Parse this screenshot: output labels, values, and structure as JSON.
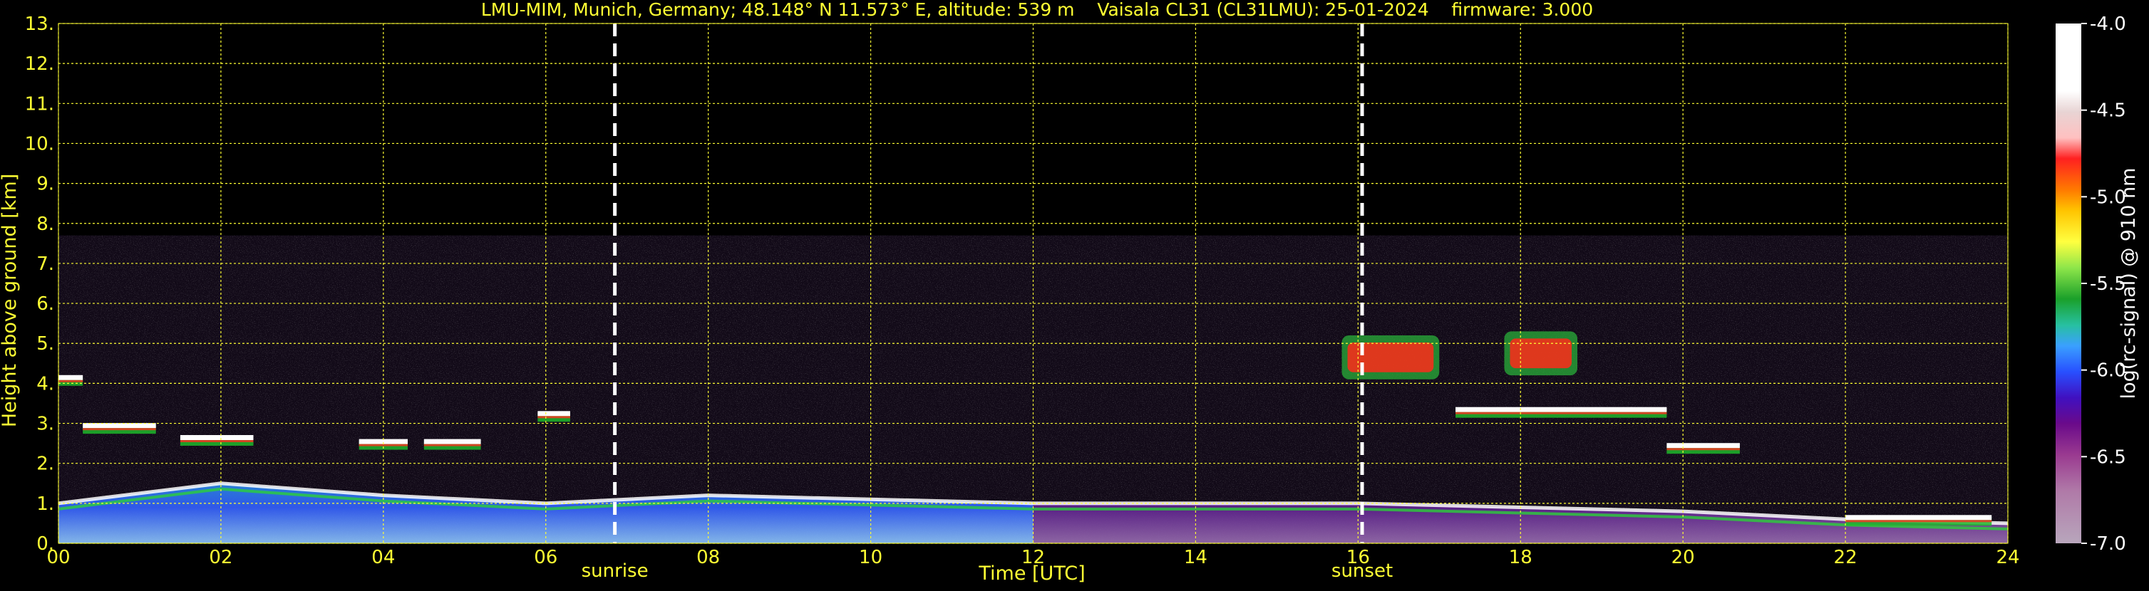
{
  "chart_data": {
    "type": "heatmap",
    "title": "LMU-MIM, Munich, Germany; 48.148° N 11.573° E, altitude: 539 m    Vaisala CL31 (CL31LMU): 25-01-2024    firmware: 3.000",
    "xlabel": "Time [UTC]",
    "ylabel": "Height above ground [km]",
    "xlim": [
      0,
      24
    ],
    "ylim": [
      0,
      13
    ],
    "x_ticks": [
      "00",
      "02",
      "04",
      "06",
      "08",
      "10",
      "12",
      "14",
      "16",
      "18",
      "20",
      "22",
      "24"
    ],
    "y_ticks": [
      "0.",
      "1.",
      "2.",
      "3.",
      "4.",
      "5.",
      "6.",
      "7.",
      "8.",
      "9.",
      "10.",
      "11.",
      "12.",
      "13."
    ],
    "grid": true,
    "colorbar": {
      "label": "log(rc-signal) @ 910 nm",
      "range": [
        -7.0,
        -4.0
      ],
      "ticks": [
        "-4.0",
        "-4.5",
        "-5.0",
        "-5.5",
        "-6.0",
        "-6.5",
        "-7.0"
      ]
    },
    "markers": [
      {
        "label": "sunrise",
        "x": 6.85
      },
      {
        "label": "sunset",
        "x": 16.05
      }
    ],
    "signal_ceiling_km": 7.7,
    "cloud_layers": [
      {
        "x_start": 0.0,
        "x_end": 0.3,
        "height_km": 4.1
      },
      {
        "x_start": 0.3,
        "x_end": 1.2,
        "height_km": 2.9
      },
      {
        "x_start": 1.5,
        "x_end": 2.4,
        "height_km": 2.6
      },
      {
        "x_start": 3.7,
        "x_end": 4.3,
        "height_km": 2.5
      },
      {
        "x_start": 4.5,
        "x_end": 5.2,
        "height_km": 2.5
      },
      {
        "x_start": 5.9,
        "x_end": 6.3,
        "height_km": 3.2
      },
      {
        "x_start": 17.2,
        "x_end": 19.8,
        "height_km": 3.3
      },
      {
        "x_start": 19.8,
        "x_end": 20.7,
        "height_km": 2.4
      },
      {
        "x_start": 22.0,
        "x_end": 23.8,
        "height_km": 0.6
      }
    ],
    "boundary_layer": [
      {
        "x": 0,
        "top_km": 1.0
      },
      {
        "x": 2,
        "top_km": 1.5
      },
      {
        "x": 4,
        "top_km": 1.2
      },
      {
        "x": 6,
        "top_km": 1.0
      },
      {
        "x": 8,
        "top_km": 1.2
      },
      {
        "x": 10,
        "top_km": 1.1
      },
      {
        "x": 12,
        "top_km": 1.0
      },
      {
        "x": 14,
        "top_km": 1.0
      },
      {
        "x": 16,
        "top_km": 1.0
      },
      {
        "x": 18,
        "top_km": 0.9
      },
      {
        "x": 20,
        "top_km": 0.8
      },
      {
        "x": 22,
        "top_km": 0.6
      },
      {
        "x": 24,
        "top_km": 0.5
      }
    ],
    "high_signal_regions": [
      {
        "x_start": 15.8,
        "x_end": 17.0,
        "y_start_km": 4.1,
        "y_end_km": 5.2
      },
      {
        "x_start": 17.8,
        "x_end": 18.7,
        "y_start_km": 4.2,
        "y_end_km": 5.3
      }
    ]
  }
}
